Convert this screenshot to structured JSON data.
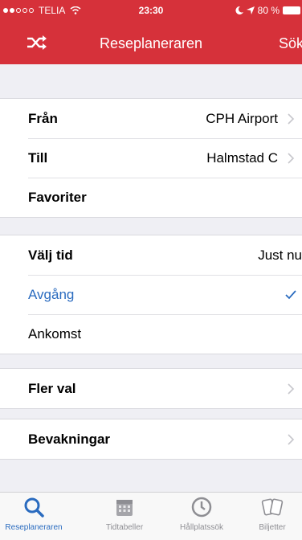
{
  "status_bar": {
    "carrier": "TELIA",
    "time": "23:30",
    "battery": "80 %"
  },
  "nav": {
    "title": "Reseplaneraren",
    "right_button": "Sök"
  },
  "route": {
    "from_label": "Från",
    "from_value": "CPH Airport",
    "to_label": "Till",
    "to_value": "Halmstad C",
    "favorites_label": "Favoriter"
  },
  "time_select": {
    "label": "Välj tid",
    "value": "Just nu",
    "departure_label": "Avgång",
    "arrival_label": "Ankomst",
    "selected": "Avgång"
  },
  "more_options_label": "Fler val",
  "subscriptions_label": "Bevakningar",
  "tabs": [
    {
      "label": "Reseplaneraren",
      "icon": "search-icon",
      "active": true
    },
    {
      "label": "Tidtabeller",
      "icon": "calendar-icon",
      "active": false
    },
    {
      "label": "Hållplatssök",
      "icon": "clock-icon",
      "active": false
    },
    {
      "label": "Biljetter",
      "icon": "tickets-icon",
      "active": false
    }
  ],
  "colors": {
    "brand_red": "#d6313a",
    "accent_blue": "#2a6bbf",
    "background": "#efeff4"
  }
}
